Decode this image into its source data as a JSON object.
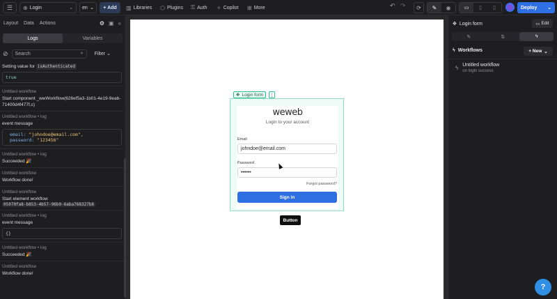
{
  "topbar": {
    "menu_icon": "menu-icon",
    "page_name": "Login",
    "language": "en",
    "add_label": "+ Add",
    "nav": [
      {
        "label": "Libraries",
        "icon": "book-icon"
      },
      {
        "label": "Plugins",
        "icon": "puzzle-icon"
      },
      {
        "label": "Auth",
        "icon": "key-icon"
      },
      {
        "label": "Copilot",
        "icon": "sparkle-icon"
      },
      {
        "label": "More",
        "icon": "grid-icon"
      }
    ],
    "deploy_label": "Deploy"
  },
  "left": {
    "tabs": [
      "Layout",
      "Data",
      "Actions"
    ],
    "segments": {
      "logs": "Logs",
      "variables": "Variables"
    },
    "search_placeholder": "Search",
    "filter_label": "Filter",
    "logs": [
      {
        "body": "Setting value for",
        "chip": "isAuthenticated",
        "code": "true"
      },
      {
        "title": "Untitled workflow",
        "body": "Start component _wwWorkflow(628ef5a3-1b01-4e19-9eab-71400d4f477f,c)"
      },
      {
        "title": "Untitled workflow • log",
        "body": "event message",
        "code_email_key": "email:",
        "code_email_val": "\"johndoe@email.com\"",
        "code_pw_key": "password:",
        "code_pw_val": "\"123456\""
      },
      {
        "title": "Untitled workflow • log",
        "body": "Succeeded 🎉"
      },
      {
        "title": "Untitled workflow",
        "body": "Workflow done!"
      },
      {
        "title": "Untitled workflow",
        "body": "Start element workflow",
        "chip": "05970fa8-b853-4b57-96b9-6aba768327b8"
      },
      {
        "title": "Untitled workflow • log",
        "body": "event message",
        "code": "{}"
      },
      {
        "title": "Untitled workflow • log",
        "body": "Succeeded 🎉"
      },
      {
        "title": "Untitled workflow",
        "body": "Workflow done!"
      }
    ]
  },
  "canvas": {
    "element_label": "Login form",
    "logo_text": "weweb",
    "subtitle": "Login to your account",
    "email_label": "Email",
    "email_value": "johndoe@email.com",
    "password_label": "Password",
    "password_value": "••••••",
    "forgot": "Forgot password?",
    "signin": "Sign in",
    "tooltip": "Button"
  },
  "right": {
    "title": "Login form",
    "edit_label": "Edit",
    "workflows_label": "Workflows",
    "new_label": "+ New",
    "workflow_name": "Untitled workflow",
    "workflow_trigger": "on login success"
  },
  "colors": {
    "accent": "#2f6fe4",
    "selection": "#2bbd8a"
  }
}
